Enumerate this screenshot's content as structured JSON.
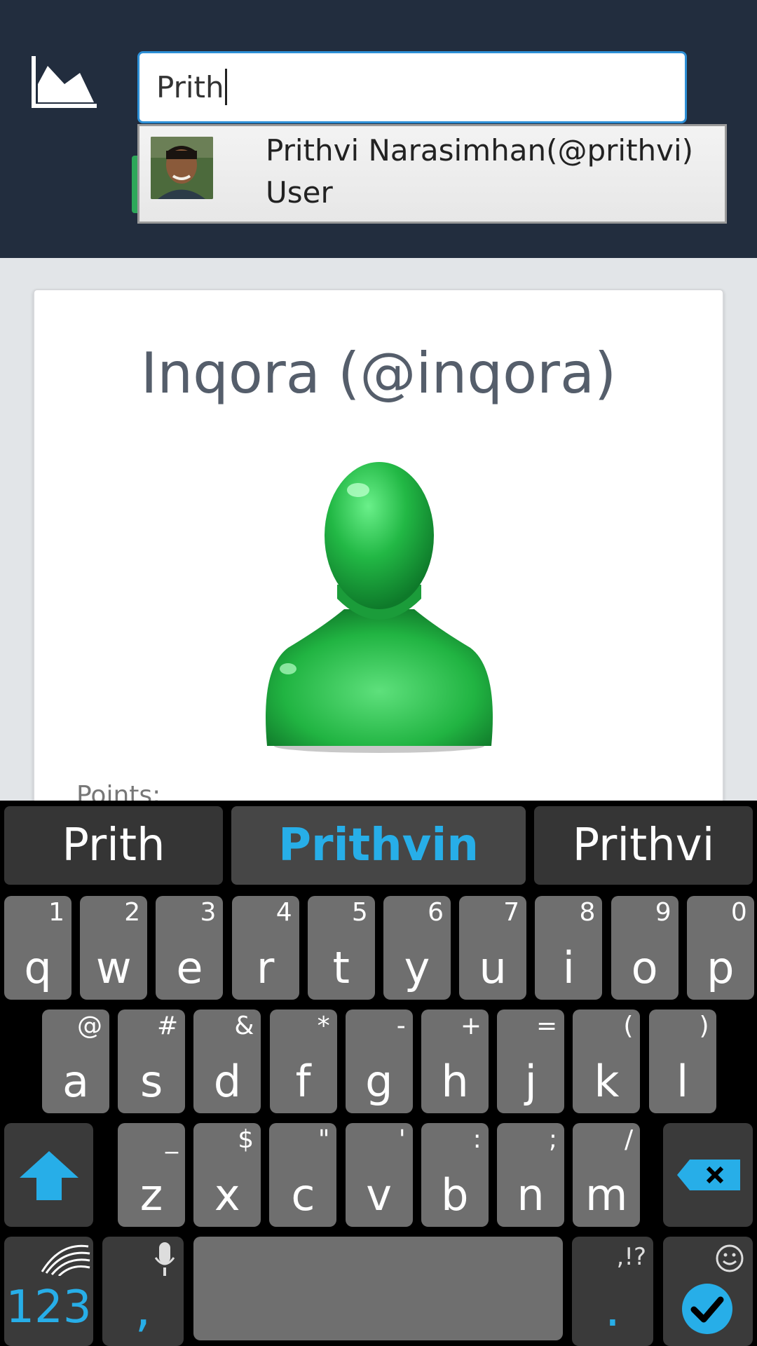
{
  "header": {
    "search": {
      "value": "Prith"
    },
    "suggestion": {
      "name": "Prithvi Narasimhan(@prithvi)",
      "type": "User"
    }
  },
  "profile": {
    "title": "Inqora (@inqora)",
    "points_label": "Points:"
  },
  "keyboard": {
    "suggestions": [
      "Prith",
      "Prithvin",
      "Prithvi"
    ],
    "row1": [
      {
        "key": "q",
        "sub": "1"
      },
      {
        "key": "w",
        "sub": "2"
      },
      {
        "key": "e",
        "sub": "3"
      },
      {
        "key": "r",
        "sub": "4"
      },
      {
        "key": "t",
        "sub": "5"
      },
      {
        "key": "y",
        "sub": "6"
      },
      {
        "key": "u",
        "sub": "7"
      },
      {
        "key": "i",
        "sub": "8"
      },
      {
        "key": "o",
        "sub": "9"
      },
      {
        "key": "p",
        "sub": "0"
      }
    ],
    "row2": [
      {
        "key": "a",
        "sub": "@"
      },
      {
        "key": "s",
        "sub": "#"
      },
      {
        "key": "d",
        "sub": "&"
      },
      {
        "key": "f",
        "sub": "*"
      },
      {
        "key": "g",
        "sub": "-"
      },
      {
        "key": "h",
        "sub": "+"
      },
      {
        "key": "j",
        "sub": "="
      },
      {
        "key": "k",
        "sub": "("
      },
      {
        "key": "l",
        "sub": ")"
      }
    ],
    "row3": [
      {
        "key": "z",
        "sub": "_"
      },
      {
        "key": "x",
        "sub": "$"
      },
      {
        "key": "c",
        "sub": "\""
      },
      {
        "key": "v",
        "sub": "'"
      },
      {
        "key": "b",
        "sub": ":"
      },
      {
        "key": "n",
        "sub": ";"
      },
      {
        "key": "m",
        "sub": "/"
      }
    ],
    "num_label": "123",
    "comma_label": ",",
    "period_label": ".",
    "period_sub": ",!?",
    "accent_color": "#27aee8"
  }
}
